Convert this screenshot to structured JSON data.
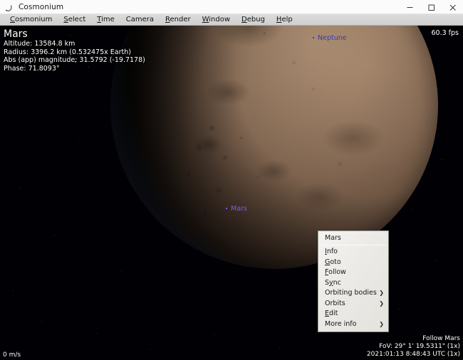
{
  "window": {
    "title": "Cosmonium",
    "icon": "comet-icon",
    "controls": {
      "minimize": "minimize-icon",
      "maximize": "maximize-icon",
      "close": "close-icon"
    }
  },
  "menubar": {
    "items": [
      {
        "label": "Cosmonium",
        "mnemonic": "C"
      },
      {
        "label": "Select",
        "mnemonic": "S"
      },
      {
        "label": "Time",
        "mnemonic": "T"
      },
      {
        "label": "Camera",
        "mnemonic": "C"
      },
      {
        "label": "Render",
        "mnemonic": "R"
      },
      {
        "label": "Window",
        "mnemonic": "W"
      },
      {
        "label": "Debug",
        "mnemonic": "D"
      },
      {
        "label": "Help",
        "mnemonic": "H"
      }
    ]
  },
  "hud": {
    "object_name": "Mars",
    "altitude": "Altitude: 13584.8 km",
    "radius": "Radius: 3396.2 km (0.532475x Earth)",
    "magnitude": "Abs (app) magnitude: 31.5792 (-19.7178)",
    "phase": "Phase: 71.8093°",
    "fps": "60.3 fps",
    "speed": "0 m/s",
    "follow": "Follow Mars",
    "fov": "FoV: 29° 1' 19.5311\" (1x)",
    "datetime": "2021:01:13  8:48:43 UTC (1x)"
  },
  "scene": {
    "labels": [
      {
        "name": "Neptune",
        "color": "#3b3bb5"
      },
      {
        "name": "Mars",
        "color": "#7b5ce0"
      }
    ]
  },
  "context_menu": {
    "title": "Mars",
    "items": [
      {
        "label": "Info",
        "mnemonic": "I",
        "submenu": false
      },
      {
        "label": "Goto",
        "mnemonic": "G",
        "submenu": false
      },
      {
        "label": "Follow",
        "mnemonic": "F",
        "submenu": false
      },
      {
        "label": "Sync",
        "mnemonic": "y",
        "submenu": false
      },
      {
        "label": "Orbiting bodies",
        "mnemonic": "",
        "submenu": true
      },
      {
        "label": "Orbits",
        "mnemonic": "",
        "submenu": true
      },
      {
        "label": "Edit",
        "mnemonic": "E",
        "submenu": false
      },
      {
        "label": "More info",
        "mnemonic": "",
        "submenu": true
      }
    ],
    "submenu_arrow": "chevron-right-icon"
  },
  "colors": {
    "titlebar_bg": "#fbfbfb",
    "menubar_bg": "#d6d6d6",
    "scene_bg": "#000005",
    "planet_surface": "#a2846a",
    "limb_glow": "#46628f",
    "hud_text": "#ffffff"
  }
}
